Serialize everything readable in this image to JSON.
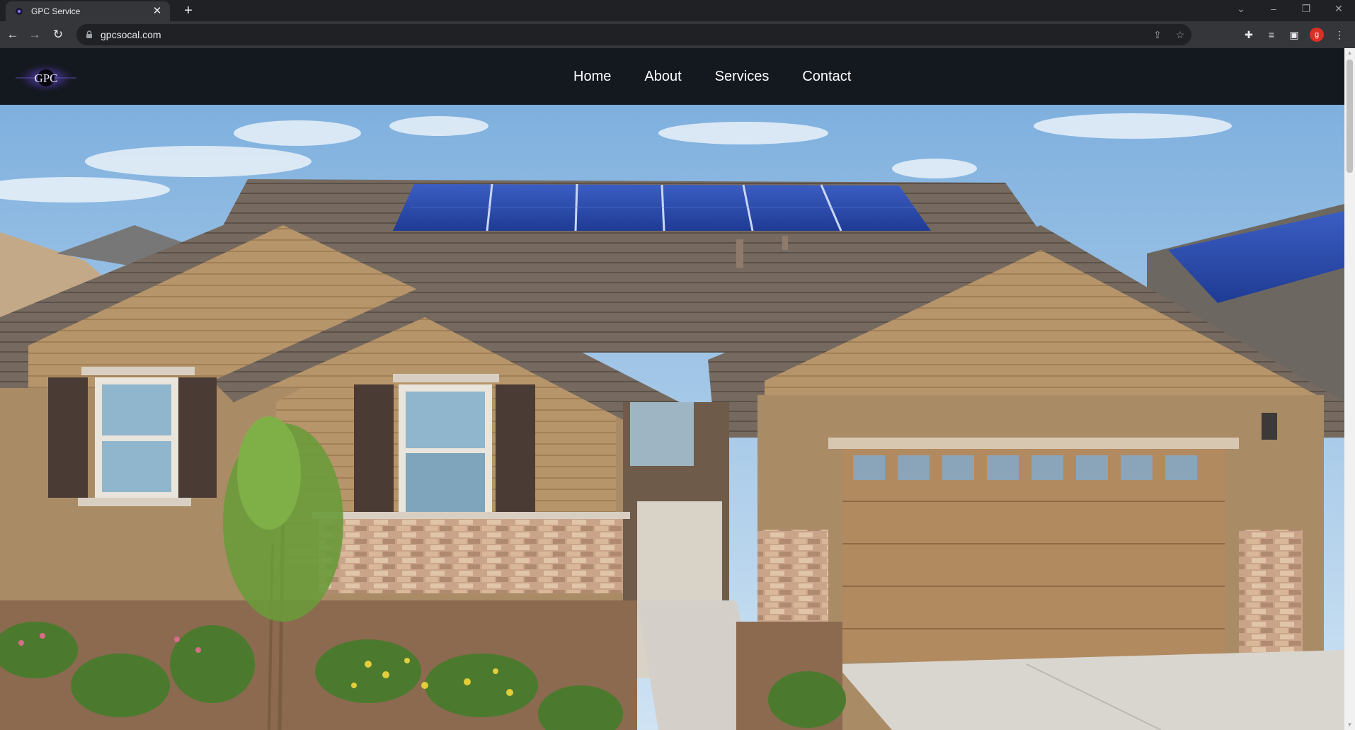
{
  "browser": {
    "tab": {
      "title": "GPC Service"
    },
    "address": {
      "url": "gpcsocal.com"
    },
    "avatar_letter": "g"
  },
  "site": {
    "logo_text": "GPC",
    "nav": [
      {
        "label": "Home"
      },
      {
        "label": "About"
      },
      {
        "label": "Services"
      },
      {
        "label": "Contact"
      }
    ]
  },
  "colors": {
    "nav_bg": "#14181f",
    "chrome_dark": "#202124",
    "chrome_toolbar": "#35363a",
    "sky": "#9dc3e6",
    "stucco": "#a88a66",
    "siding": "#b9986a",
    "roof": "#6e6259",
    "solar_panel": "#2c47a8"
  },
  "icons": {
    "back": "arrow-left",
    "forward": "arrow-right",
    "reload": "reload",
    "lock": "lock",
    "share": "share",
    "star": "star",
    "extensions": "puzzle",
    "media": "media-queue",
    "sidepanel": "side-panel",
    "menu": "kebab"
  }
}
